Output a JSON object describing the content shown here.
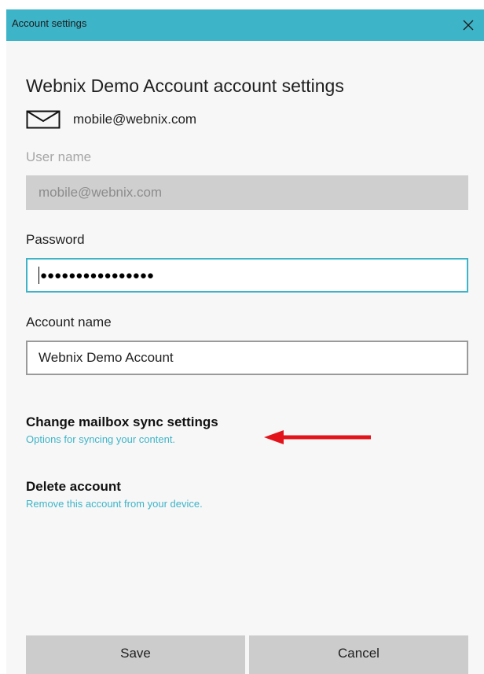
{
  "window": {
    "title": "Account settings",
    "close_icon": "close-icon"
  },
  "heading": "Webnix Demo Account account settings",
  "account_email": {
    "icon": "mail-icon",
    "text": "mobile@webnix.com"
  },
  "username": {
    "label": "User name",
    "value": "mobile@webnix.com",
    "disabled": true
  },
  "password": {
    "label": "Password",
    "masked_value": "●●●●●●●●●●●●●●●●"
  },
  "account_name": {
    "label": "Account name",
    "value": "Webnix Demo Account"
  },
  "sync_settings": {
    "title": "Change mailbox sync settings",
    "subtitle": "Options for syncing your content."
  },
  "delete_account": {
    "title": "Delete account",
    "subtitle": "Remove this account from your device."
  },
  "annotation": {
    "arrow_color": "#e3131b"
  },
  "buttons": {
    "save": "Save",
    "cancel": "Cancel"
  },
  "colors": {
    "accent": "#3eb4c8",
    "button_bg": "#cccccc",
    "disabled_field_bg": "#cfcfcf"
  }
}
